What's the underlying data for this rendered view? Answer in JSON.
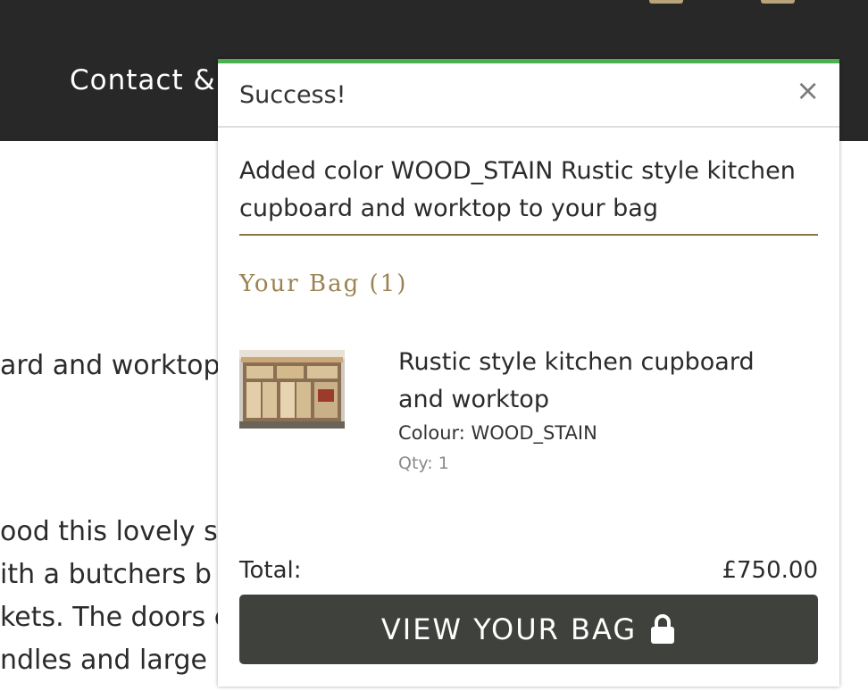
{
  "nav": {
    "contact_label": "Contact &"
  },
  "background_text": [
    "ard and worktop",
    "ood this lovely s",
    "ith a butchers b",
    "kets. The doors c",
    "ndles and large"
  ],
  "toast": {
    "title": "Success!",
    "close_symbol": "×",
    "message": "Added color WOOD_STAIN Rustic style kitchen cupboard and worktop to your bag",
    "bag_heading": "Your Bag (1)",
    "item": {
      "title": "Rustic style kitchen cupboard and worktop",
      "colour": "Colour: WOOD_STAIN",
      "qty": "Qty: 1",
      "thumbnail_icon": "cupboard-photo"
    },
    "total_label": "Total:",
    "total_value": "£750.00",
    "view_button_label": "VIEW YOUR BAG",
    "view_button_icon": "lock-icon"
  },
  "colors": {
    "navbar": "#282828",
    "success_accent": "#4caf50",
    "heading_gold": "#9a8352",
    "button_dark": "#3e413c"
  }
}
